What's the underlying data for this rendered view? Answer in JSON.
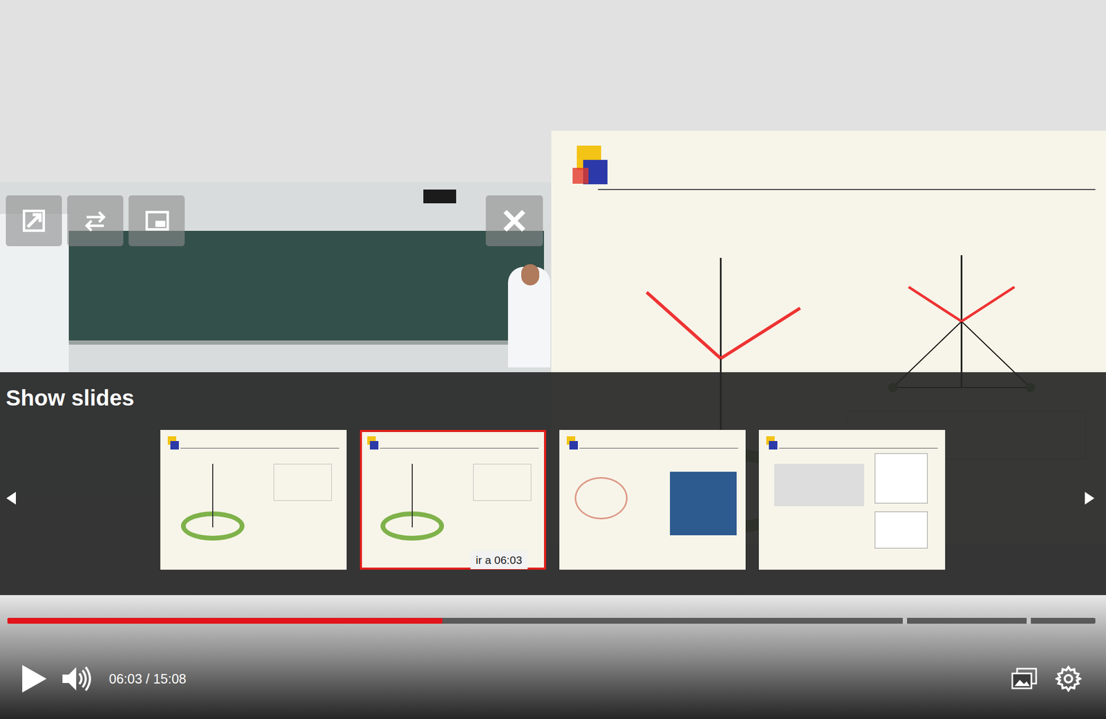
{
  "overlay_title": "Show slides",
  "thumbnails": [
    {
      "selected": false
    },
    {
      "selected": true
    },
    {
      "selected": false
    },
    {
      "selected": false
    }
  ],
  "tooltip": "ir a 06:03",
  "progress": {
    "level": 0.4,
    "chapter_marks": [
      0.823,
      0.937
    ]
  },
  "time": "06:03 / 15:08"
}
